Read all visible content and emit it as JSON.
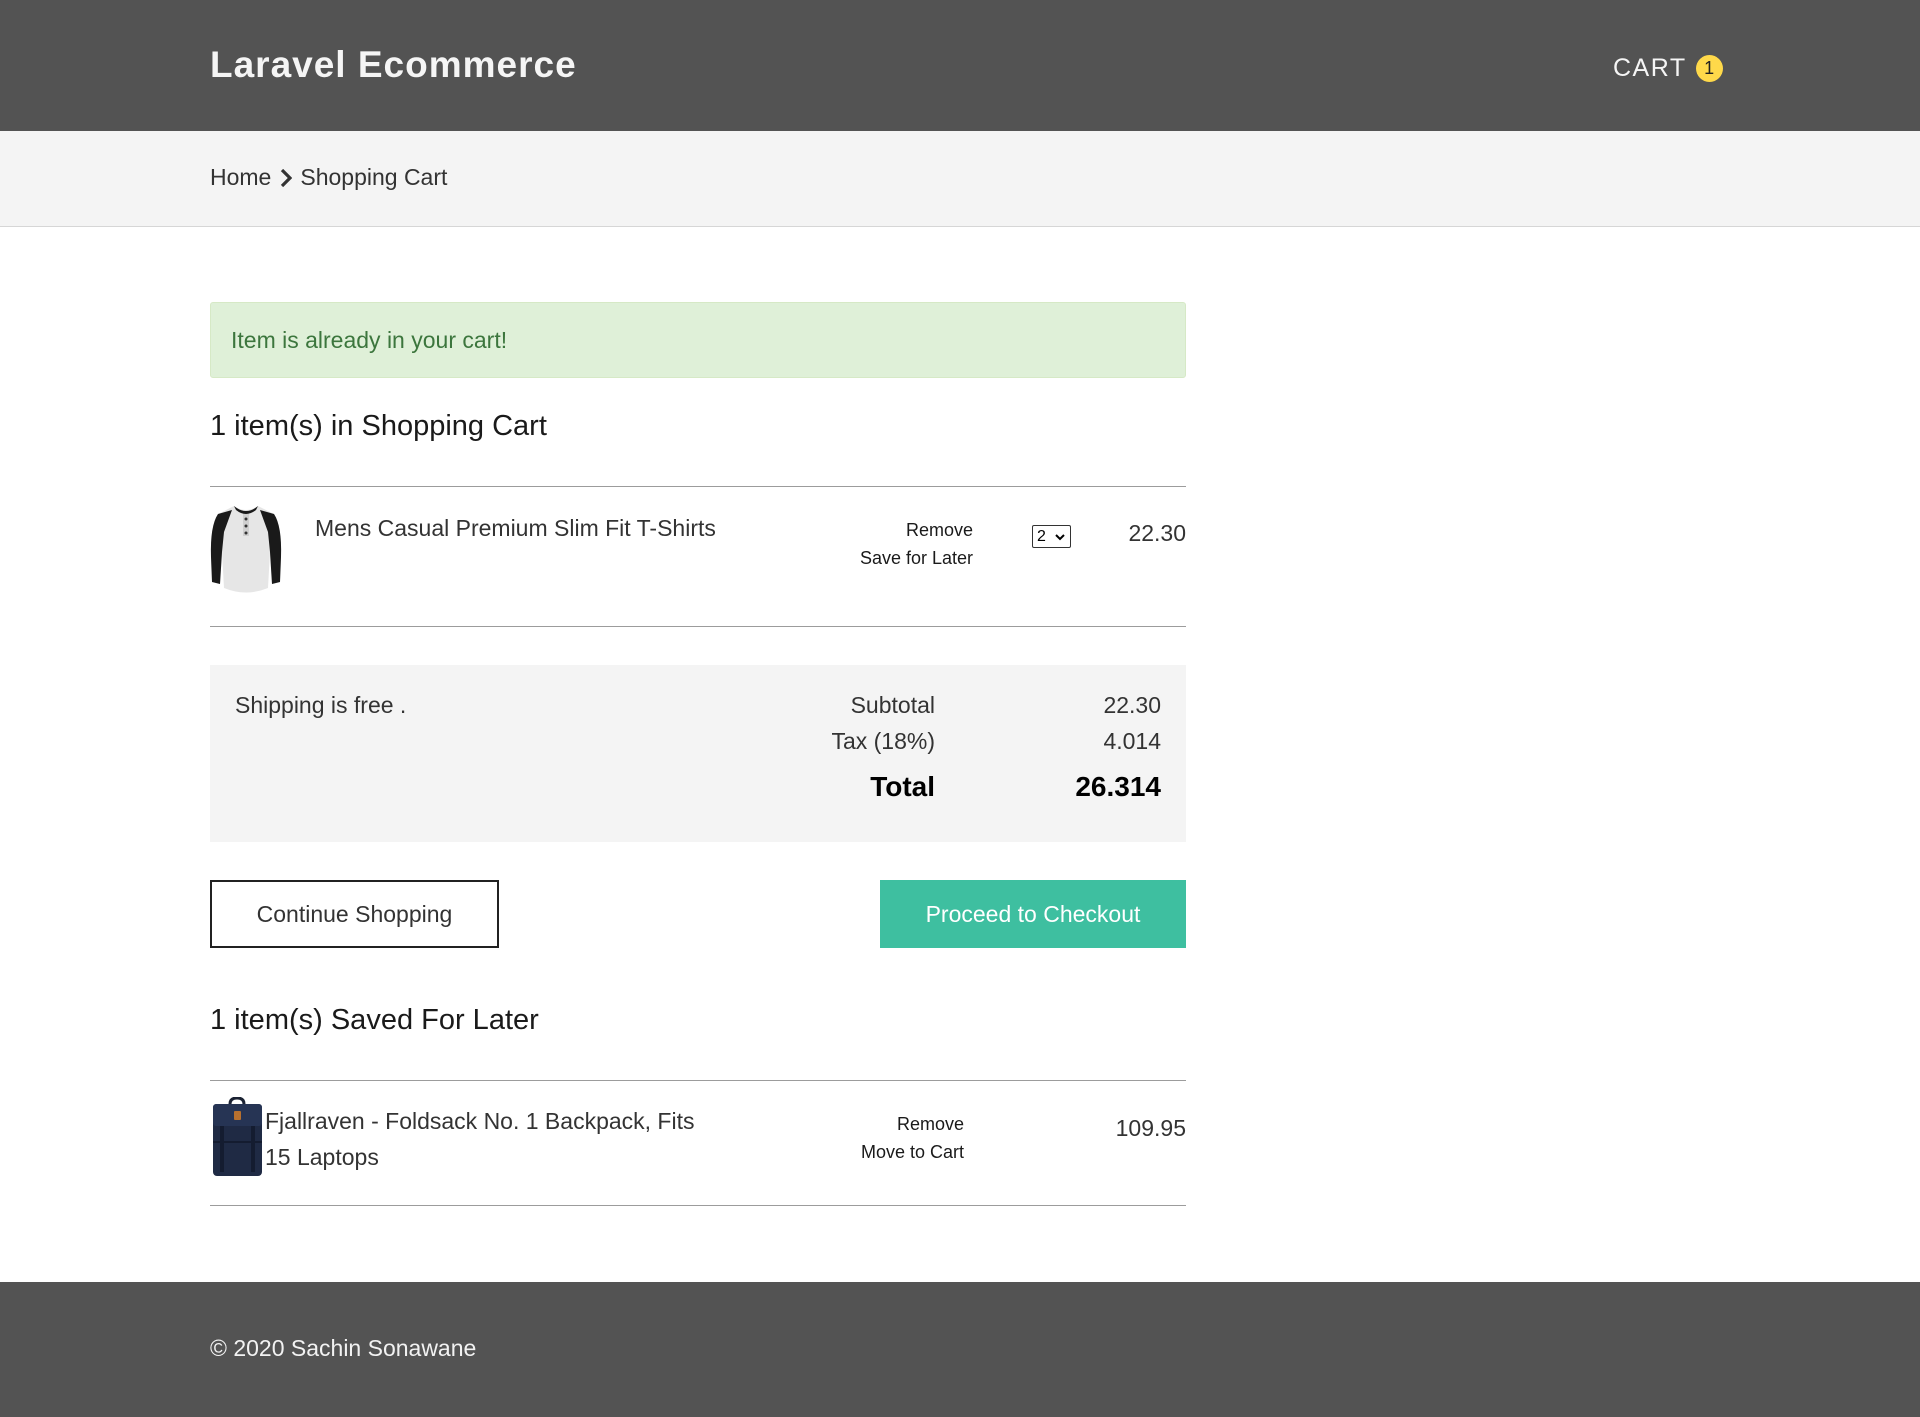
{
  "header": {
    "brand": "Laravel Ecommerce",
    "cart_label": "CART",
    "cart_count": "1"
  },
  "breadcrumb": {
    "home": "Home",
    "current": "Shopping Cart"
  },
  "alert": {
    "message": "Item is already in your cart!"
  },
  "cart": {
    "title": "1 item(s) in Shopping Cart",
    "items": [
      {
        "name": "Mens Casual Premium Slim Fit T-Shirts",
        "remove_label": "Remove",
        "save_label": "Save for Later",
        "quantity": "2",
        "price": "22.30",
        "image_icon": "t-shirt-icon"
      }
    ]
  },
  "totals": {
    "shipping_note": "Shipping is free .",
    "subtotal_label": "Subtotal",
    "subtotal_value": "22.30",
    "tax_label": "Tax (18%)",
    "tax_value": "4.014",
    "total_label": "Total",
    "total_value": "26.314"
  },
  "actions": {
    "continue_label": "Continue Shopping",
    "checkout_label": "Proceed to Checkout"
  },
  "saved": {
    "title": "1 item(s) Saved For Later",
    "items": [
      {
        "name_line1": "Fjallraven - Foldsack No. 1 Backpack, Fits",
        "name_line2": "15 Laptops",
        "remove_label": "Remove",
        "move_label": "Move to Cart",
        "price": "109.95",
        "image_icon": "backpack-icon"
      }
    ]
  },
  "footer": {
    "copyright": "© 2020 Sachin Sonawane"
  },
  "colors": {
    "header_bg": "#535353",
    "badge": "#ffd94a",
    "alert_bg": "#dff0d8",
    "alert_text": "#3c763d",
    "checkout_bg": "#3ebfa0"
  }
}
